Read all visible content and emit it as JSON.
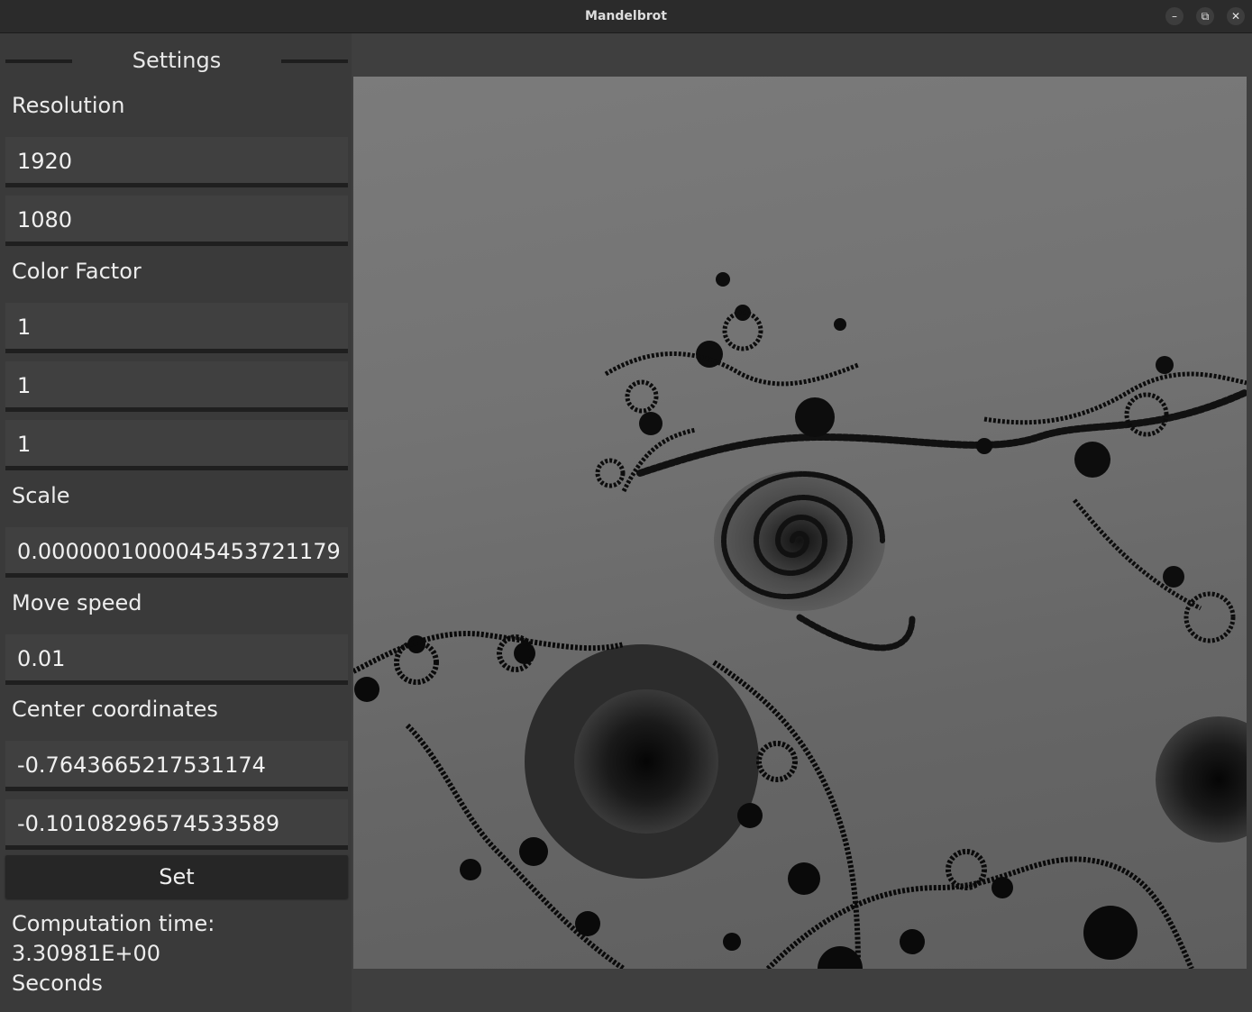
{
  "window": {
    "title": "Mandelbrot",
    "minimize_icon": "–",
    "restore_icon": "⧉",
    "close_icon": "✕"
  },
  "settings": {
    "header": "Settings",
    "resolution": {
      "label": "Resolution",
      "width": "1920",
      "height": "1080"
    },
    "color_factor": {
      "label": "Color Factor",
      "r": "1",
      "g": "1",
      "b": "1"
    },
    "scale": {
      "label": "Scale",
      "value": "0.0000001000045453721179"
    },
    "move_speed": {
      "label": "Move speed",
      "value": "0.01"
    },
    "center": {
      "label": "Center coordinates",
      "x": "-0.7643665217531174",
      "y": "-0.10108296574533589"
    },
    "set_button": "Set",
    "computation": {
      "line1": "Computation time:",
      "line2": "3.30981E+00",
      "line3": "Seconds"
    }
  },
  "colors": {
    "titlebar": "#2b2b2b",
    "panel": "#3a3a3a",
    "field": "#404040",
    "field_underline": "#1f1f1f",
    "button": "#262626",
    "fractal_bg": "#777777",
    "fractal_ink": "#0a0a0a"
  }
}
